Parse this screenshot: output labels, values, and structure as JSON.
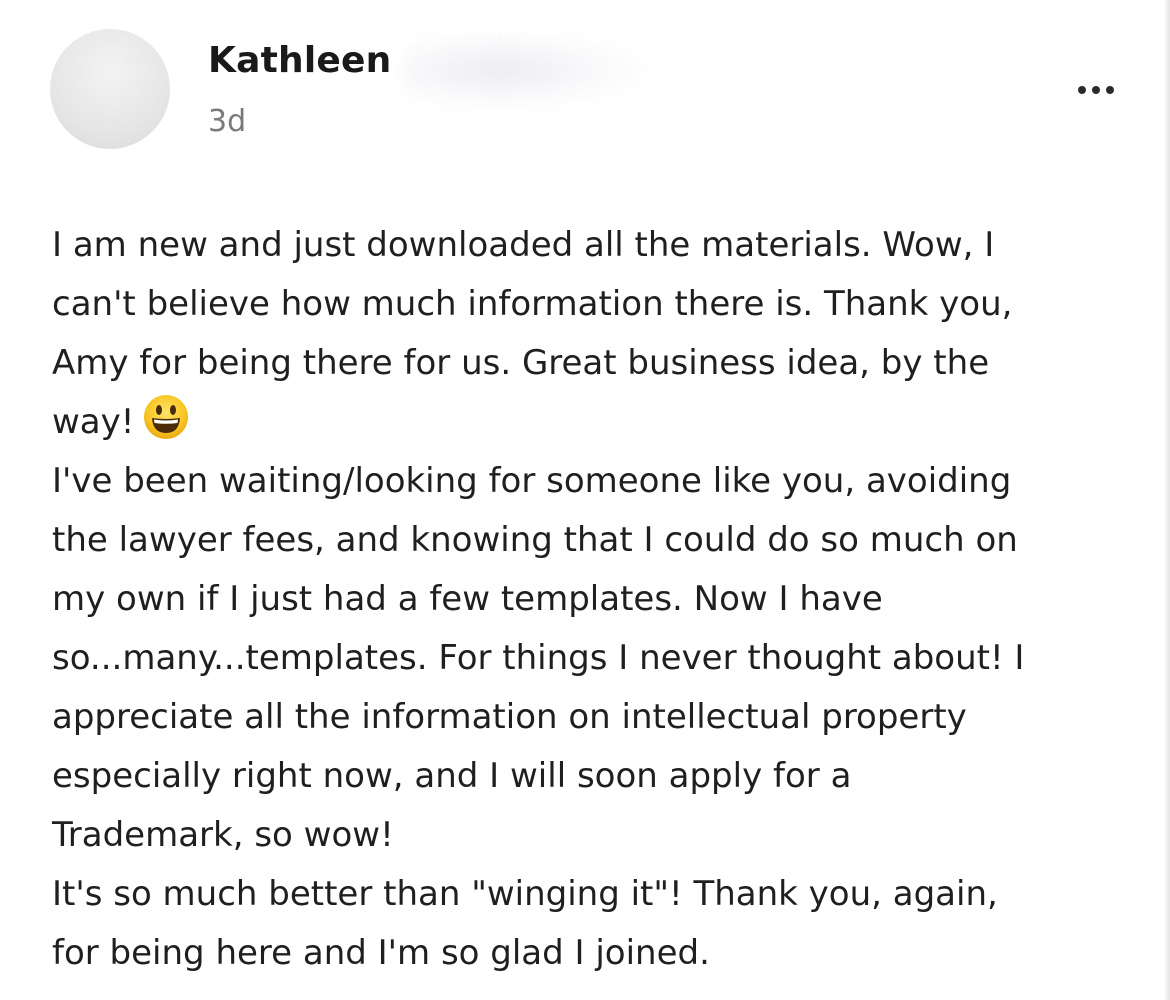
{
  "post": {
    "author": {
      "name": "Kathleen",
      "time_ago": "3d"
    },
    "menu": {
      "icon": "more-horizontal-icon"
    },
    "lines": [
      "I am new and just downloaded all the materials. Wow, I",
      "can't believe how much information there is. Thank you,",
      "Amy for being there for us. Great business idea, by the",
      "way!",
      "I've been waiting/looking for someone like you, avoiding",
      "the lawyer fees, and knowing that I could do so much on",
      "my own if I just had a few templates. Now I have",
      "so...many...templates. For things I never thought about! I",
      "appreciate all the information on intellectual property",
      "especially right now, and I will soon apply for a",
      "Trademark, so wow!",
      "It's so much better than \"winging it\"! Thank you, again,",
      "for being here and I'm so glad I joined."
    ],
    "emoji": "grinning-face-emoji"
  }
}
